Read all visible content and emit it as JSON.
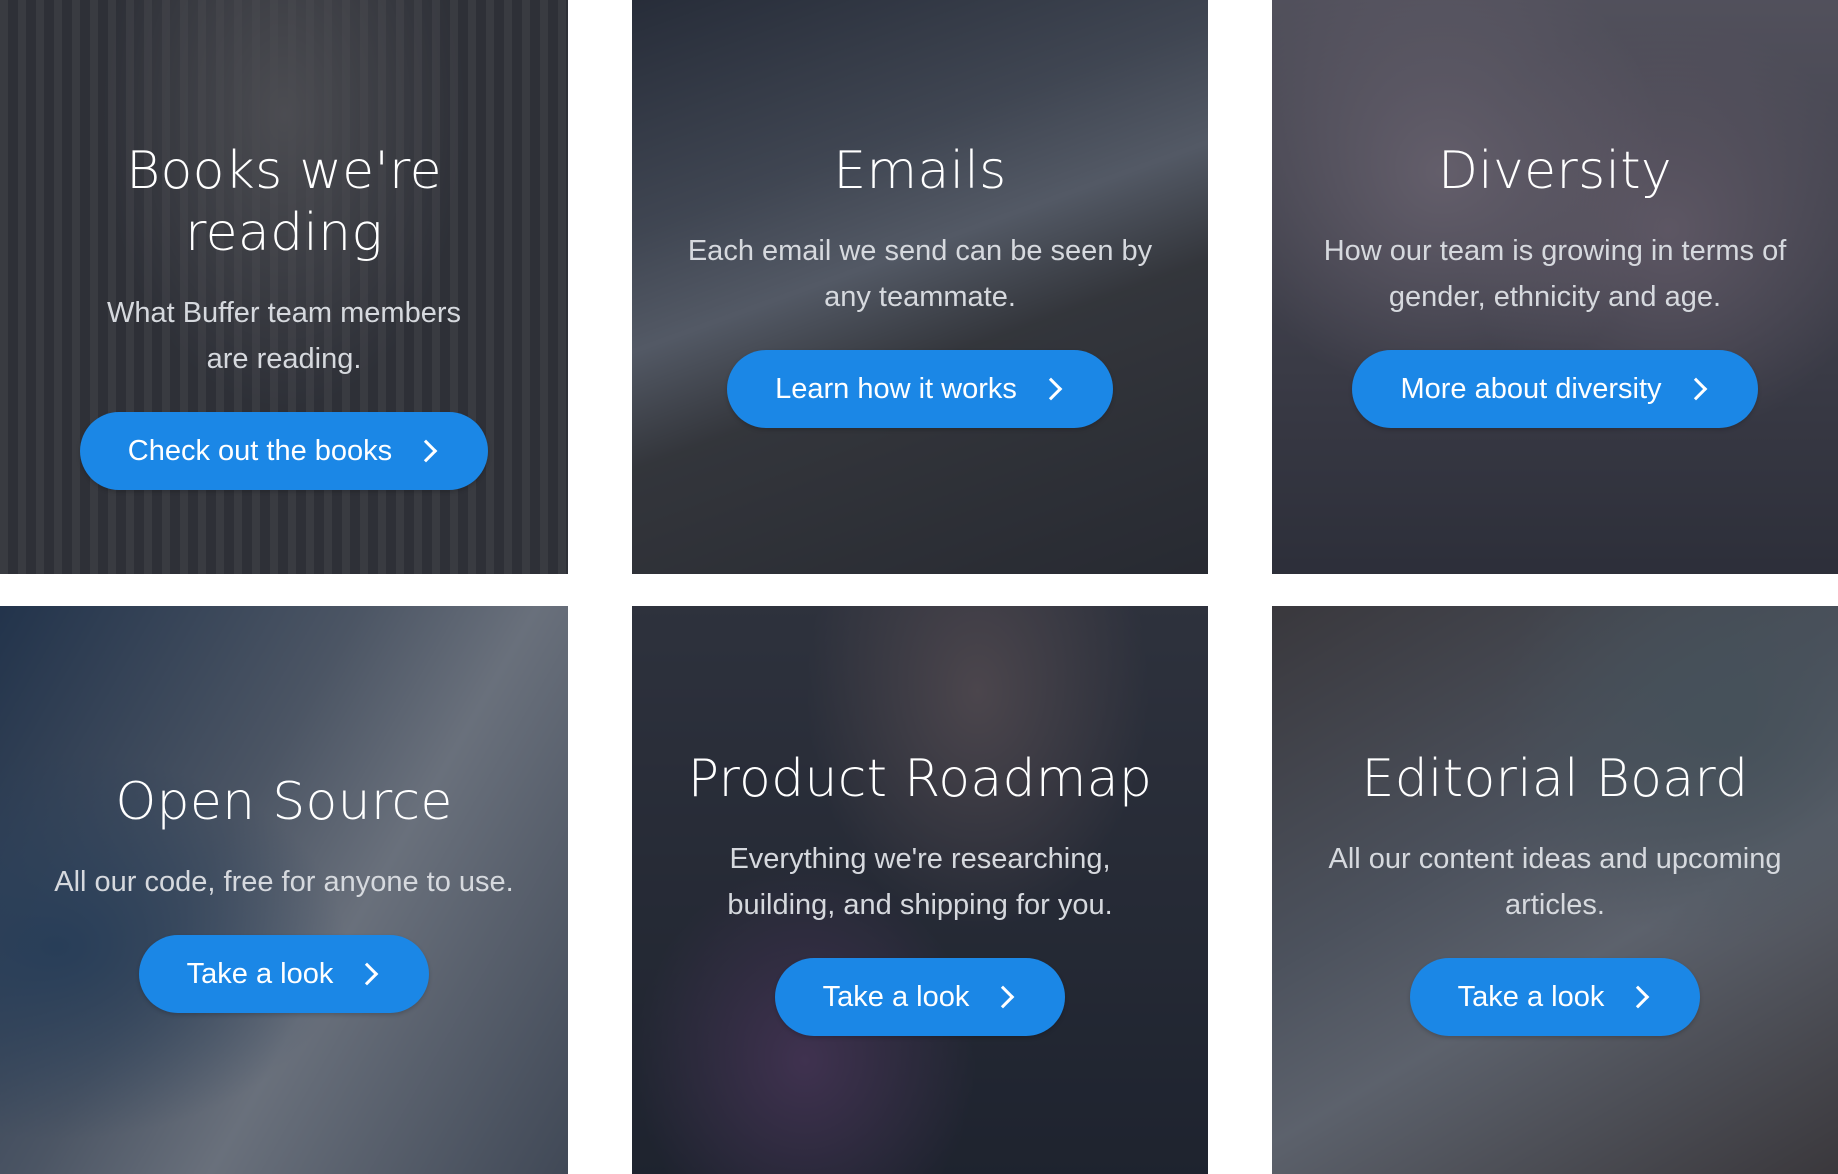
{
  "cards": [
    {
      "title": "Books we're reading",
      "description": "What Buffer team members are reading.",
      "button": "Check out the books"
    },
    {
      "title": "Emails",
      "description": "Each email we send can be seen by any teammate.",
      "button": "Learn how it works"
    },
    {
      "title": "Diversity",
      "description": "How our team is growing in terms of gender, ethnicity and age.",
      "button": "More about diversity"
    },
    {
      "title": "Open Source",
      "description": "All our code, free for anyone to use.",
      "button": "Take a look"
    },
    {
      "title": "Product Roadmap",
      "description": "Everything we're researching, building, and shipping for you.",
      "button": "Take a look"
    },
    {
      "title": "Editorial Board",
      "description": "All our content ideas and upcoming articles.",
      "button": "Take a look"
    }
  ],
  "colors": {
    "button": "#1b87e6",
    "overlay": "#252d3e",
    "text": "#ffffff",
    "description": "#d6d9de"
  },
  "icons": {
    "button_icon": "chevron-right-icon"
  }
}
